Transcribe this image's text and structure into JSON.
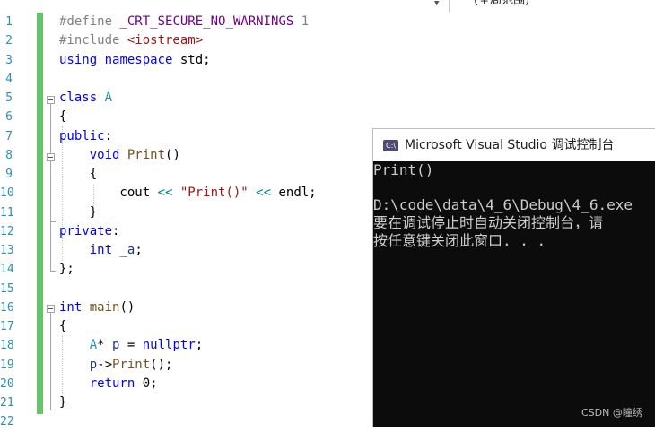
{
  "toolbar": {
    "scope_label": "(全局范围)",
    "dropdown_caret": "▼"
  },
  "editor": {
    "line_numbers": [
      "1",
      "2",
      "3",
      "4",
      "5",
      "6",
      "7",
      "8",
      "9",
      "10",
      "11",
      "12",
      "13",
      "14",
      "15",
      "16",
      "17",
      "18",
      "19",
      "20",
      "21",
      "22"
    ],
    "code": {
      "l1": {
        "a": "#define ",
        "b": "_CRT_SECURE_NO_WARNINGS",
        "c": " 1"
      },
      "l2": {
        "a": "#include ",
        "b": "<iostream>"
      },
      "l3": {
        "a": "using",
        "b": " ",
        "c": "namespace",
        "d": " std;"
      },
      "l5": {
        "a": "class",
        "b": " ",
        "c": "A"
      },
      "l6": {
        "a": "{"
      },
      "l7": {
        "a": "public",
        "b": ":"
      },
      "l8": {
        "a": "    ",
        "b": "void",
        "c": " ",
        "d": "Print",
        "e": "()"
      },
      "l9": {
        "a": "    {"
      },
      "l10": {
        "a": "        cout ",
        "b": "<<",
        "c": " ",
        "d": "\"Print()\"",
        "e": " ",
        "f": "<<",
        "g": " endl;"
      },
      "l11": {
        "a": "    }"
      },
      "l12": {
        "a": "private",
        "b": ":"
      },
      "l13": {
        "a": "    ",
        "b": "int",
        "c": " ",
        "d": "_a",
        "e": ";"
      },
      "l14": {
        "a": "};"
      },
      "l16": {
        "a": "int",
        "b": " ",
        "c": "main",
        "d": "()"
      },
      "l17": {
        "a": "{"
      },
      "l18": {
        "a": "    ",
        "b": "A",
        "c": "* ",
        "d": "p",
        "e": " = ",
        "f": "nullptr",
        "g": ";"
      },
      "l19": {
        "a": "    ",
        "b": "p",
        "c": "->",
        "d": "Print",
        "e": "();"
      },
      "l20": {
        "a": "    ",
        "b": "return",
        "c": " 0;"
      },
      "l21": {
        "a": "}"
      }
    }
  },
  "console": {
    "icon_text": "C:\\",
    "title": "Microsoft Visual Studio 调试控制台",
    "lines": [
      "Print()",
      "",
      "D:\\code\\data\\4_6\\Debug\\4_6.exe",
      "要在调试停止时自动关闭控制台，请",
      "按任意键关闭此窗口. . ."
    ],
    "watermark": "CSDN @瞳绣"
  },
  "colors": {
    "keyword": "#0000ff",
    "preprocessor": "#808080",
    "string": "#a31515",
    "type": "#2b91af",
    "function": "#74531f",
    "macro": "#6f008a",
    "line_number": "#2b91af",
    "change_bar": "#63c76a",
    "console_bg": "#0c0c0c",
    "console_text": "#cccccc"
  }
}
